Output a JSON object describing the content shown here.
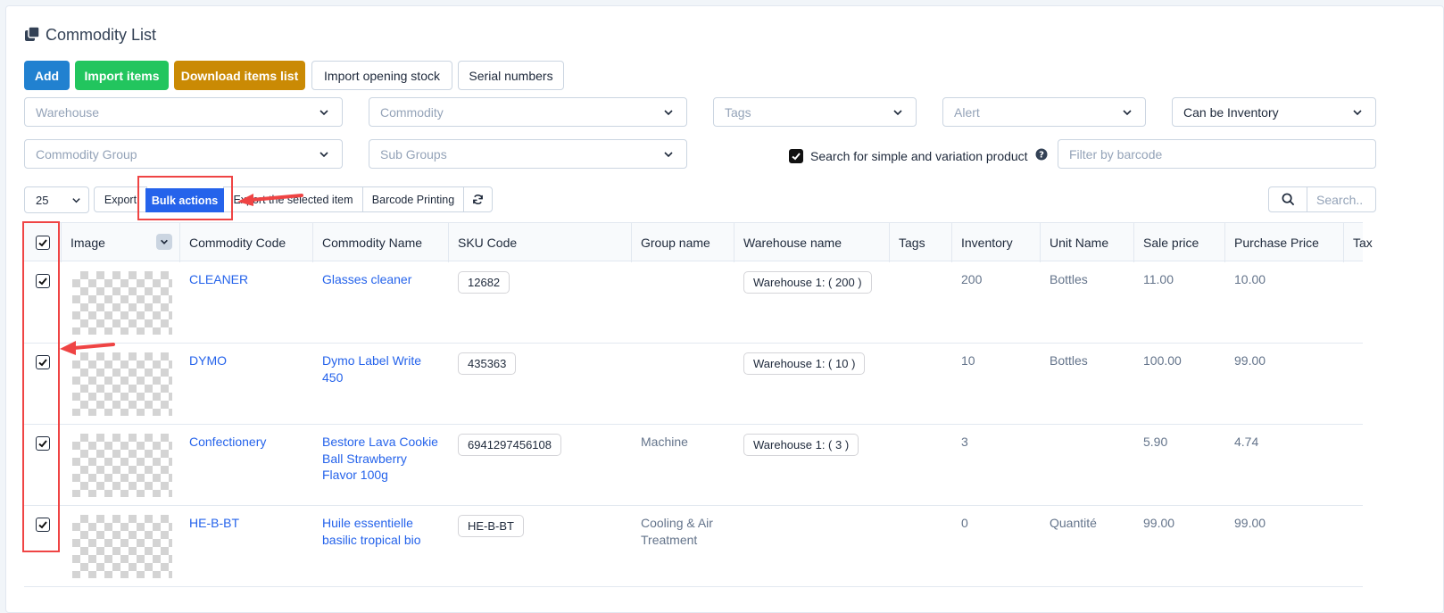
{
  "page": {
    "title": "Commodity List"
  },
  "actions": {
    "add": "Add",
    "import_items": "Import items",
    "download_items_list": "Download items list",
    "import_opening_stock": "Import opening stock",
    "serial_numbers": "Serial numbers"
  },
  "filters": {
    "warehouse": "Warehouse",
    "commodity": "Commodity",
    "tags": "Tags",
    "alert": "Alert",
    "inventory_type": "Can be Inventory",
    "commodity_group": "Commodity Group",
    "sub_groups": "Sub Groups",
    "variation_search_label": "Search for simple and variation product",
    "variation_search_checked": true,
    "barcode_placeholder": "Filter by barcode"
  },
  "toolbar": {
    "page_size": "25",
    "export": "Export",
    "bulk_actions": "Bulk actions",
    "export_selected": "Export the selected item",
    "barcode_printing": "Barcode Printing",
    "search_placeholder": "Search.."
  },
  "table": {
    "headers": {
      "image": "Image",
      "commodity_code": "Commodity Code",
      "commodity_name": "Commodity Name",
      "sku_code": "SKU Code",
      "group_name": "Group name",
      "warehouse_name": "Warehouse name",
      "tags": "Tags",
      "inventory": "Inventory",
      "unit_name": "Unit Name",
      "sale_price": "Sale price",
      "purchase_price": "Purchase Price",
      "tax": "Tax"
    },
    "rows": [
      {
        "checked": true,
        "code": "CLEANER",
        "name": [
          "Glasses cleaner"
        ],
        "sku": "12682",
        "group": [],
        "warehouse": "Warehouse 1: ( 200 )",
        "tags": "",
        "inventory": "200",
        "unit": "Bottles",
        "sale_price": "11.00",
        "purchase_price": "10.00"
      },
      {
        "checked": true,
        "code": "DYMO",
        "name": [
          "Dymo Label Write",
          "450"
        ],
        "sku": "435363",
        "group": [],
        "warehouse": "Warehouse 1: ( 10 )",
        "tags": "",
        "inventory": "10",
        "unit": "Bottles",
        "sale_price": "100.00",
        "purchase_price": "99.00"
      },
      {
        "checked": true,
        "code": "Confectionery",
        "name": [
          "Bestore Lava Cookie",
          "Ball Strawberry",
          "Flavor 100g"
        ],
        "sku": "6941297456108",
        "group": [
          "Machine"
        ],
        "warehouse": "Warehouse 1: ( 3 )",
        "tags": "",
        "inventory": "3",
        "unit": "",
        "sale_price": "5.90",
        "purchase_price": "4.74"
      },
      {
        "checked": true,
        "code": "HE-B-BT",
        "name": [
          "Huile essentielle",
          "basilic tropical bio"
        ],
        "sku": "HE-B-BT",
        "group": [
          "Cooling & Air",
          "Treatment"
        ],
        "warehouse": "",
        "tags": "",
        "inventory": "0",
        "unit": "Quantité",
        "sale_price": "99.00",
        "purchase_price": "99.00"
      }
    ]
  },
  "icons": {
    "title": "copy-icon",
    "chevron": "chevron-down-icon",
    "refresh": "refresh-icon",
    "search": "search-icon",
    "help": "help-circle-icon",
    "check": "check-icon"
  },
  "colors": {
    "primary": "#2181d0",
    "success": "#22c55e",
    "warning": "#ca8a04",
    "bulk": "#2563eb",
    "annotation": "#ef4444"
  }
}
